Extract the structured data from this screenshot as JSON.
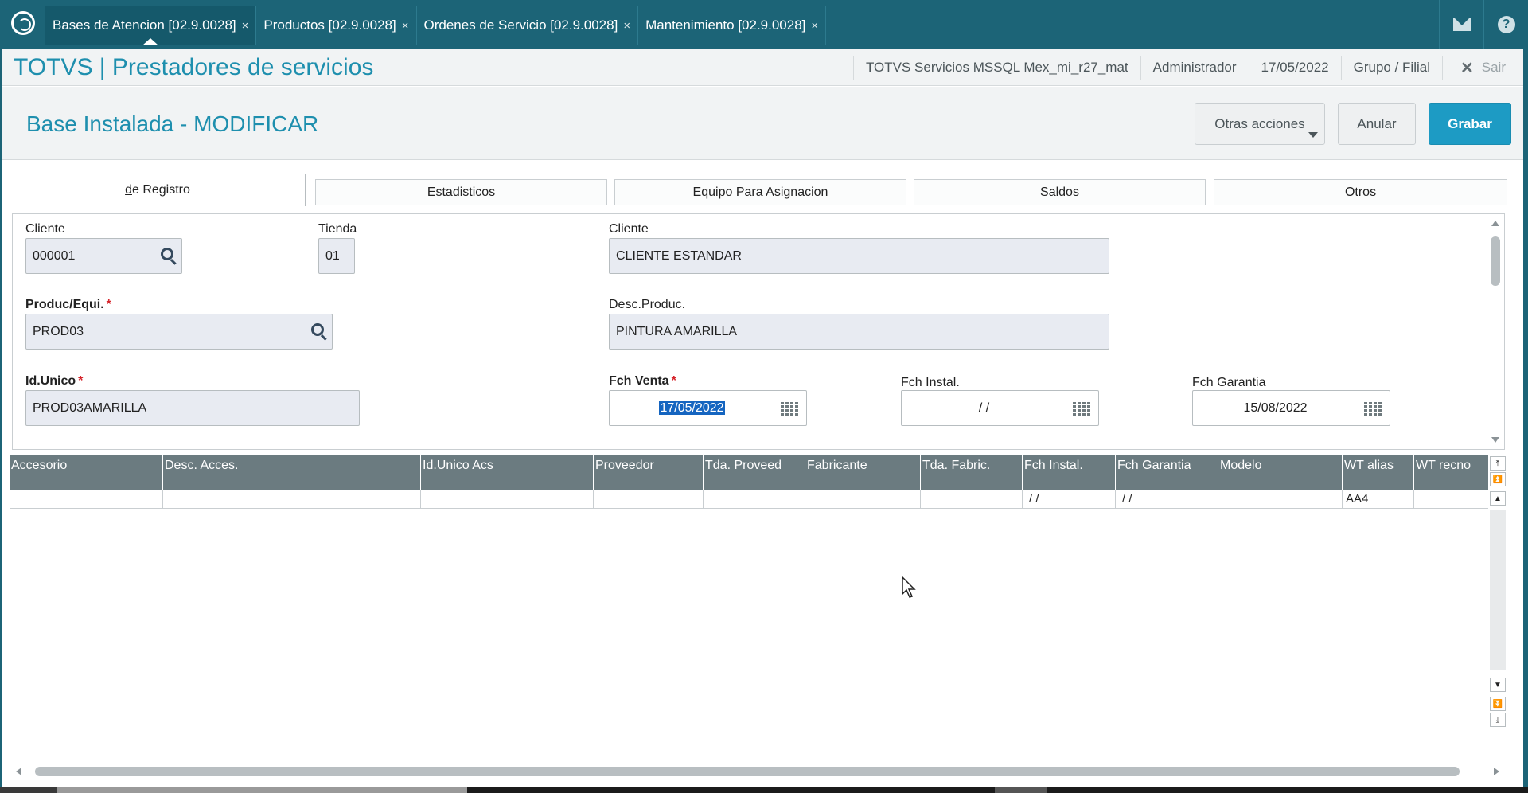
{
  "tabs": [
    {
      "label": "Bases de Atencion [02.9.0028]",
      "active": true
    },
    {
      "label": "Productos [02.9.0028]",
      "active": false
    },
    {
      "label": "Ordenes de Servicio [02.9.0028]",
      "active": false
    },
    {
      "label": "Mantenimiento [02.9.0028]",
      "active": false
    }
  ],
  "tab_close": "×",
  "header": {
    "app_title": "TOTVS | Prestadores de servicios",
    "environment": "TOTVS Servicios MSSQL Mex_mi_r27_mat",
    "user": "Administrador",
    "date": "17/05/2022",
    "group": "Grupo / Filial",
    "exit_label": "Sair"
  },
  "page": {
    "title": "Base Instalada - MODIFICAR",
    "btn_otras": "Otras acciones",
    "btn_anular": "Anular",
    "btn_grabar": "Grabar"
  },
  "form_tabs": {
    "registro_prefix": "",
    "registro_underline": "d",
    "registro_rest": "e Registro",
    "estadisticos_u": "E",
    "estadisticos_rest": "stadisticos",
    "equipo": "Equipo Para Asignacion",
    "saldos_u": "S",
    "saldos_rest": "aldos",
    "otros_u": "O",
    "otros_rest": "tros"
  },
  "form": {
    "cliente_label": "Cliente",
    "cliente_value": "000001",
    "tienda_label": "Tienda",
    "tienda_value": "01",
    "cliente_name_label": "Cliente",
    "cliente_name_value": "CLIENTE ESTANDAR",
    "produc_label": "Produc/Equi.",
    "produc_value": "PROD03",
    "desc_label": "Desc.Produc.",
    "desc_value": "PINTURA AMARILLA",
    "idunico_label": "Id.Unico",
    "idunico_value": "PROD03AMARILLA",
    "fchventa_label": "Fch Venta",
    "fchventa_value": "17/05/2022",
    "fchinstal_label": "Fch Instal.",
    "fchinstal_value": "/  /",
    "fchgarantia_label": "Fch Garantia",
    "fchgarantia_value": "15/08/2022",
    "required_mark": "*"
  },
  "grid": {
    "columns": [
      "Accesorio",
      "Desc. Acces.",
      "Id.Unico Acs",
      "Proveedor",
      "Tda. Proveed",
      "Fabricante",
      "Tda. Fabric.",
      "Fch Instal.",
      "Fch Garantia",
      "Modelo",
      "WT alias",
      "WT recno"
    ],
    "row": [
      "",
      "",
      "",
      "",
      "",
      "",
      "",
      " /  /",
      " /  /",
      "",
      "AA4",
      ""
    ]
  }
}
